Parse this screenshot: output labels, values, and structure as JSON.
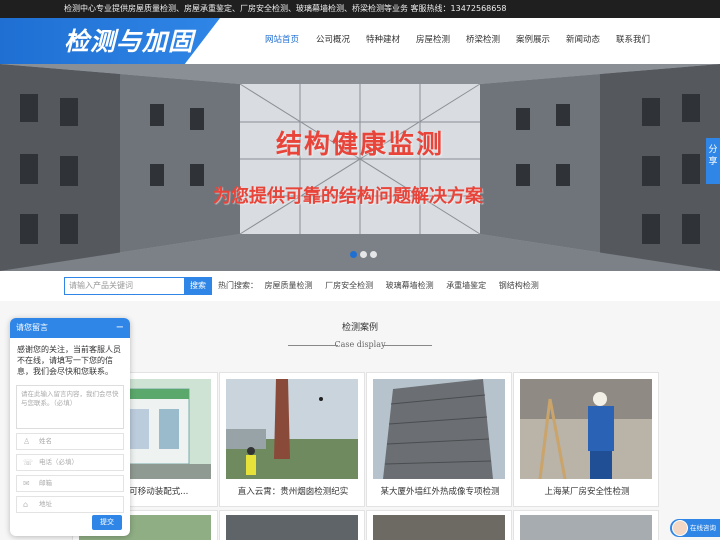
{
  "topbar": {
    "message": "检测中心专业提供房屋质量检测、房屋承重鉴定、厂房安全检测、玻璃幕墙检测、桥梁检测等业务 客服热线：13472568658"
  },
  "logo": {
    "text": "检测与加固"
  },
  "nav": [
    {
      "label": "网站首页",
      "active": true
    },
    {
      "label": "公司概况"
    },
    {
      "label": "特种建材"
    },
    {
      "label": "房屋检测"
    },
    {
      "label": "桥梁检测"
    },
    {
      "label": "案例展示"
    },
    {
      "label": "新闻动态"
    },
    {
      "label": "联系我们"
    }
  ],
  "banner": {
    "title": "结构健康监测",
    "subtitle": "为您提供可靠的结构问题解决方案",
    "share": "分享"
  },
  "search": {
    "placeholder": "请输入产品关键词",
    "button": "搜索",
    "hot_label": "热门搜索：",
    "keywords": [
      "房屋质量检测",
      "厂房安全检测",
      "玻璃幕墙检测",
      "承重墙鉴定",
      "钢结构检测"
    ]
  },
  "cases": {
    "title": "检测案例",
    "subtitle": "Case display",
    "items": [
      {
        "caption": "功实施可移动装配式..."
      },
      {
        "caption": "直入云霄：贵州烟囱检测纪实"
      },
      {
        "caption": "某大厦外墙红外热成像专项检测"
      },
      {
        "caption": "上海某厂房安全性检测"
      }
    ]
  },
  "chat": {
    "title": "请您留言",
    "minimize": "−",
    "message": "感谢您的关注，当前客服人员不在线，请填写一下您的信息，我们会尽快和您联系。",
    "textarea_placeholder": "请在此输入留言内容，我们会尽快与您联系。（必填）",
    "fields": [
      "姓名",
      "电话（必填）",
      "邮箱",
      "地址"
    ],
    "submit": "提交"
  },
  "online": {
    "label": "在线咨询"
  },
  "colors": {
    "accent": "#2f86e6",
    "banner_text": "#e8443a"
  }
}
